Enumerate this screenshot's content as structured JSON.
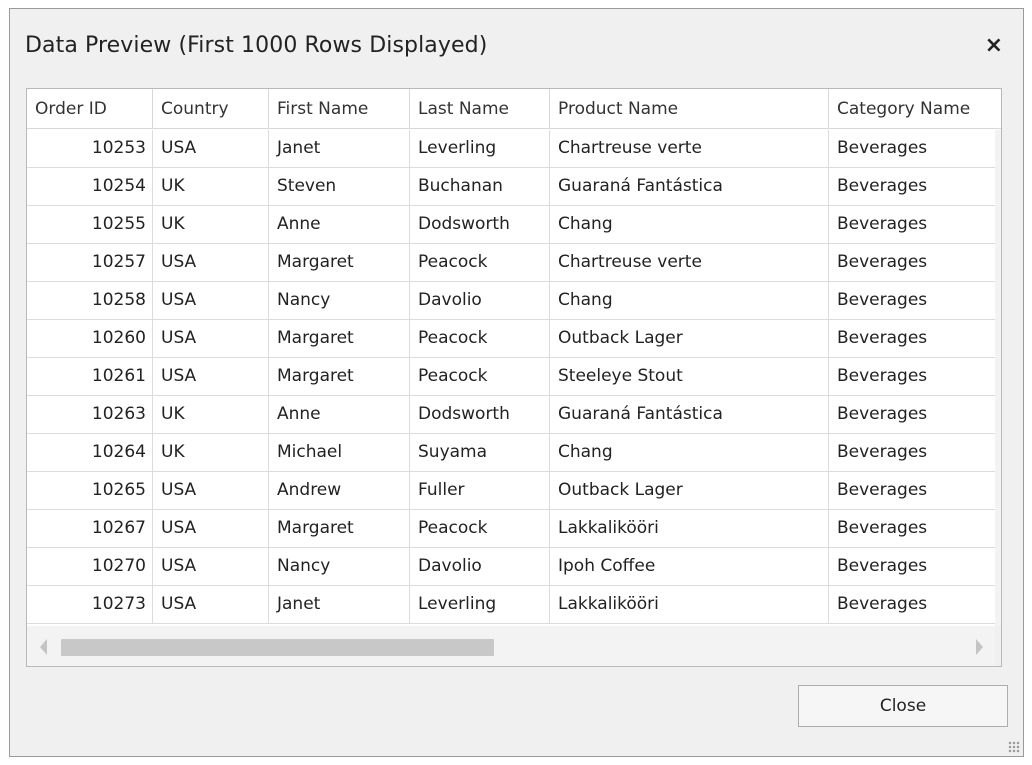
{
  "dialog": {
    "title": "Data Preview (First 1000 Rows Displayed)",
    "close_icon": "×",
    "close_button_label": "Close"
  },
  "grid": {
    "columns": [
      "Order ID",
      "Country",
      "First Name",
      "Last Name",
      "Product Name",
      "Category Name"
    ],
    "rows": [
      [
        "10253",
        "USA",
        "Janet",
        "Leverling",
        "Chartreuse verte",
        "Beverages"
      ],
      [
        "10254",
        "UK",
        "Steven",
        "Buchanan",
        "Guaraná Fantástica",
        "Beverages"
      ],
      [
        "10255",
        "UK",
        "Anne",
        "Dodsworth",
        "Chang",
        "Beverages"
      ],
      [
        "10257",
        "USA",
        "Margaret",
        "Peacock",
        "Chartreuse verte",
        "Beverages"
      ],
      [
        "10258",
        "USA",
        "Nancy",
        "Davolio",
        "Chang",
        "Beverages"
      ],
      [
        "10260",
        "USA",
        "Margaret",
        "Peacock",
        "Outback Lager",
        "Beverages"
      ],
      [
        "10261",
        "USA",
        "Margaret",
        "Peacock",
        "Steeleye Stout",
        "Beverages"
      ],
      [
        "10263",
        "UK",
        "Anne",
        "Dodsworth",
        "Guaraná Fantástica",
        "Beverages"
      ],
      [
        "10264",
        "UK",
        "Michael",
        "Suyama",
        "Chang",
        "Beverages"
      ],
      [
        "10265",
        "USA",
        "Andrew",
        "Fuller",
        "Outback Lager",
        "Beverages"
      ],
      [
        "10267",
        "USA",
        "Margaret",
        "Peacock",
        "Lakkalikööri",
        "Beverages"
      ],
      [
        "10270",
        "USA",
        "Nancy",
        "Davolio",
        "Ipoh Coffee",
        "Beverages"
      ],
      [
        "10273",
        "USA",
        "Janet",
        "Leverling",
        "Lakkalikööri",
        "Beverages"
      ]
    ]
  }
}
